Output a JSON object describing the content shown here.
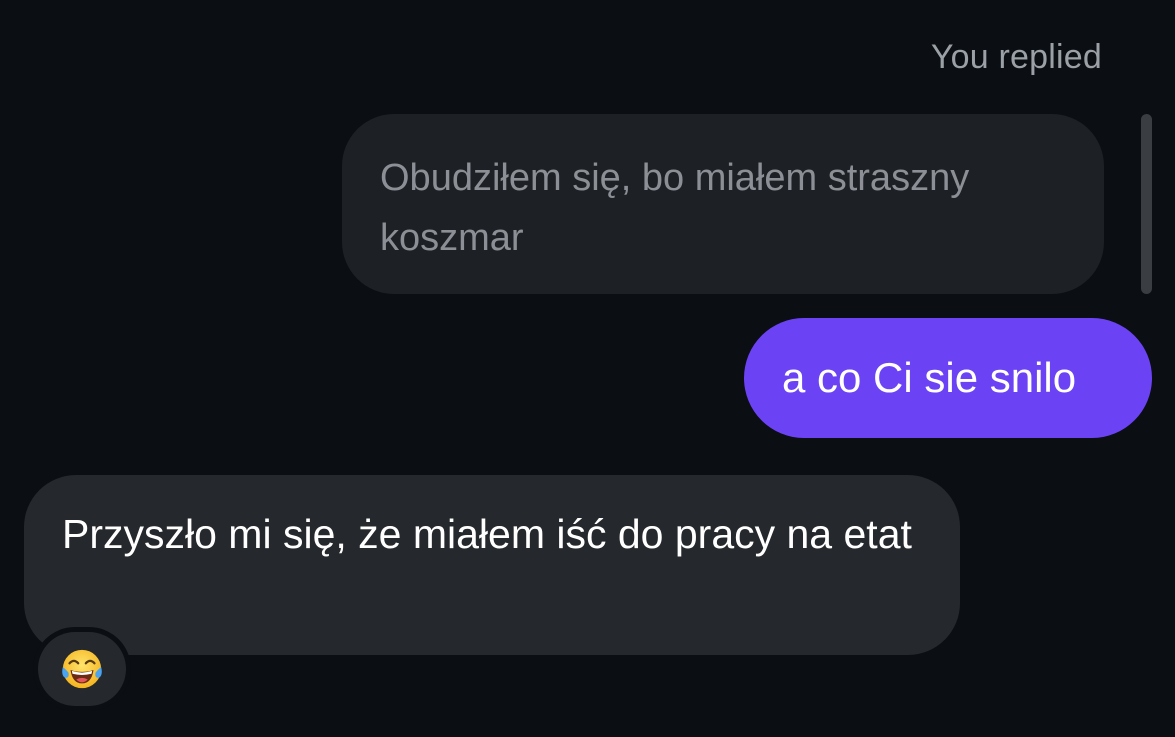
{
  "reply_label": "You replied",
  "quoted_message": {
    "text": "Obudziłem się, bo miałem straszny koszmar"
  },
  "sent_message": {
    "text": "a co Ci sie snilo"
  },
  "received_message": {
    "text": "Przyszło mi się, że miałem iść do pracy na etat"
  },
  "reaction": {
    "emoji": "😂",
    "icon": "face-with-tears-of-joy-icon"
  },
  "colors": {
    "background": "#0b0e13",
    "sent_bubble": "#6b43f5",
    "received_bubble": "#25282c",
    "quoted_bubble": "#1d2024"
  }
}
